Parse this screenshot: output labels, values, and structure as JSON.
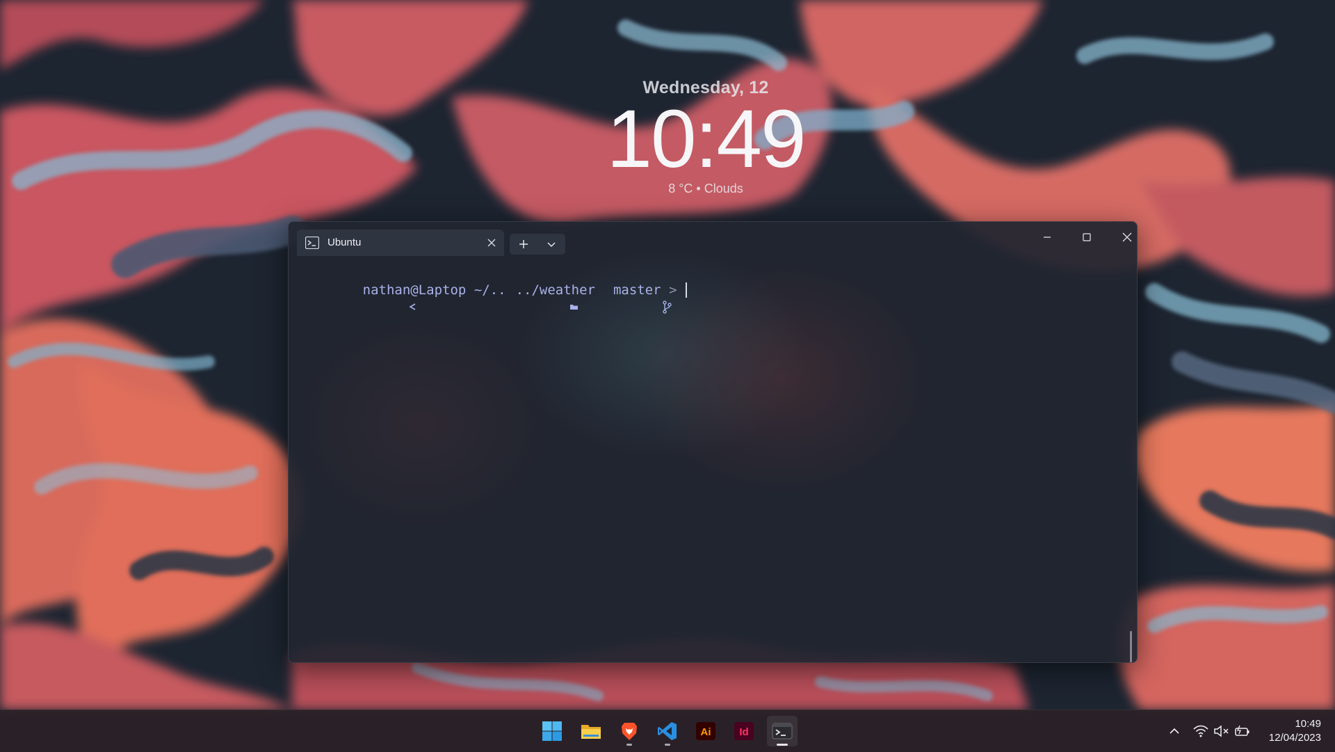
{
  "desktop": {
    "clock_widget": {
      "date": "Wednesday, 12",
      "time": "10:49",
      "weather": "8 °C • Clouds"
    }
  },
  "terminal": {
    "tab": {
      "title": "Ubuntu",
      "icon": "terminal-prompt-icon"
    },
    "controls": {
      "new_tab_icon": "plus-icon",
      "dropdown_icon": "chevron-down-icon",
      "minimize_icon": "minimize-icon",
      "maximize_icon": "maximize-icon",
      "close_icon": "close-icon"
    },
    "prompt": {
      "user_host": "nathan@Laptop",
      "path_prefix": "~/..",
      "path_suffix": "../weather",
      "branch": "master",
      "end_symbol": ">"
    },
    "colors": {
      "prompt_text": "#a8b2e8",
      "background": "#212630"
    }
  },
  "taskbar": {
    "apps": [
      {
        "name": "Start",
        "icon": "windows-logo-icon"
      },
      {
        "name": "File Explorer",
        "icon": "folder-icon"
      },
      {
        "name": "Brave",
        "icon": "brave-lion-icon"
      },
      {
        "name": "Visual Studio Code",
        "icon": "vscode-icon"
      },
      {
        "name": "Adobe Illustrator",
        "icon": "illustrator-icon",
        "label": "Ai"
      },
      {
        "name": "Adobe InDesign",
        "icon": "indesign-icon",
        "label": "Id"
      },
      {
        "name": "Windows Terminal",
        "icon": "terminal-icon"
      }
    ],
    "tray": {
      "icons": [
        "chevron-up-icon",
        "wifi-icon",
        "volume-muted-icon",
        "battery-icon"
      ],
      "time": "10:49",
      "date": "12/04/2023"
    }
  }
}
